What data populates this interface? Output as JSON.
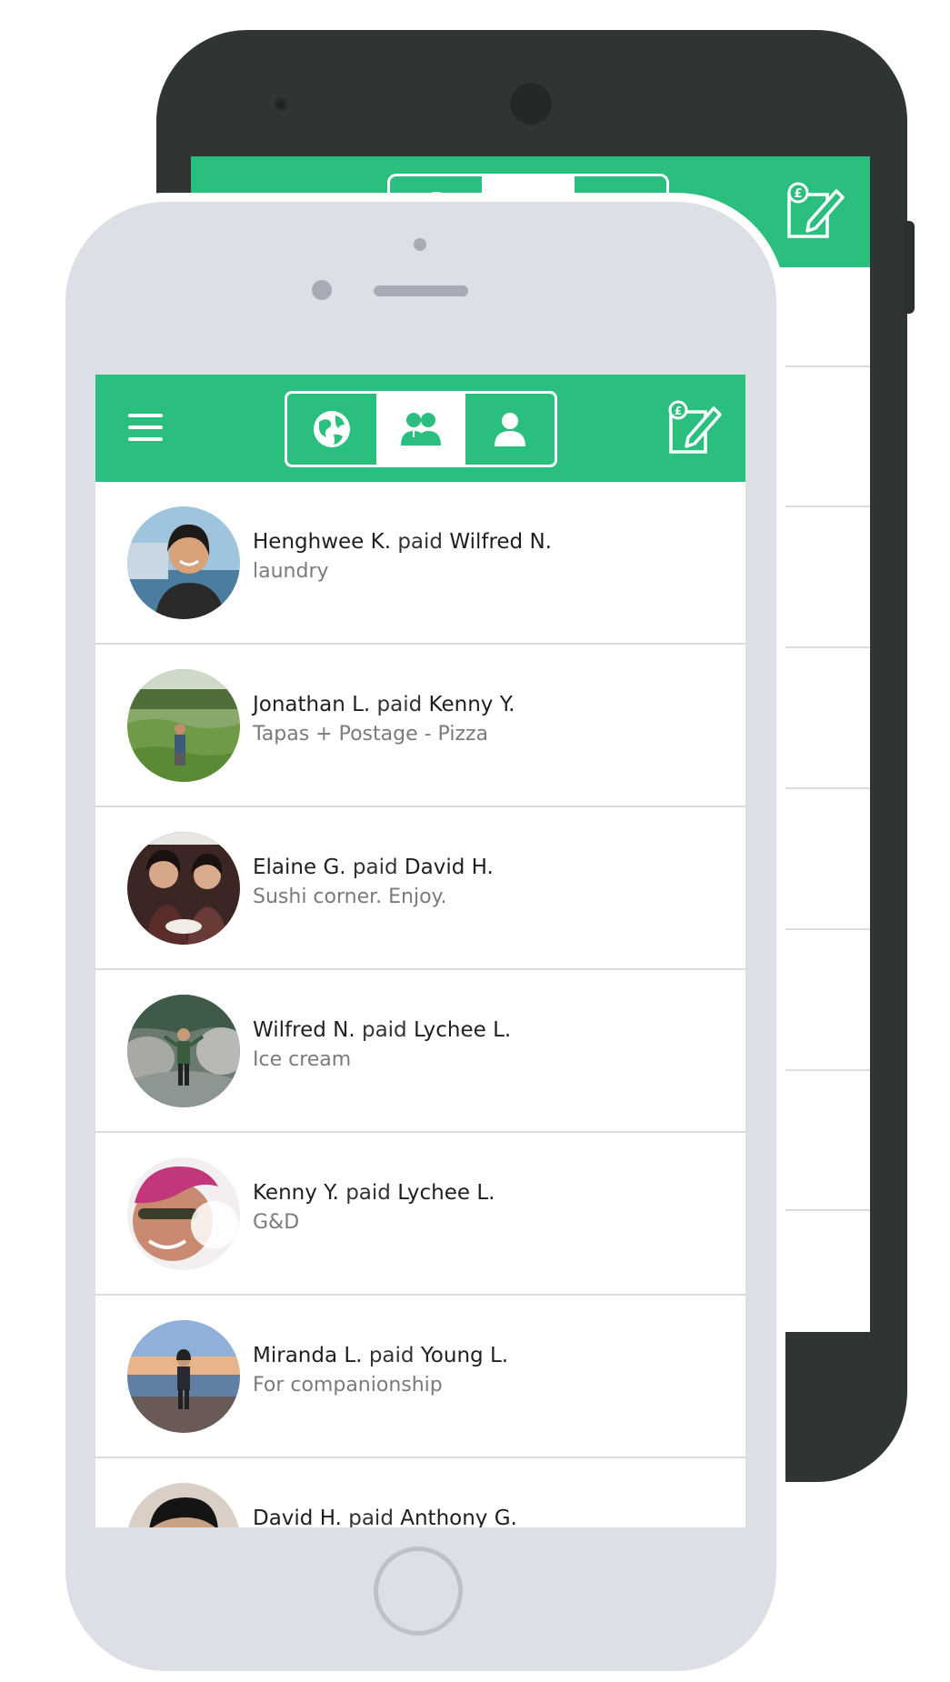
{
  "colors": {
    "accent": "#2bbf7f",
    "android_body": "#2e3533",
    "iphone_body": "#dcdfe6"
  },
  "header": {
    "menu_icon": "hamburger-menu-icon",
    "tabs": [
      {
        "name": "global",
        "icon": "globe-icon",
        "active": false
      },
      {
        "name": "friends",
        "icon": "friends-icon",
        "active": true
      },
      {
        "name": "personal",
        "icon": "person-icon",
        "active": false
      }
    ],
    "compose_icon": "compose-payment-icon"
  },
  "feed": [
    {
      "payer": "Henghwee K.",
      "verb": "paid",
      "payee": "Wilfred N.",
      "note": "laundry"
    },
    {
      "payer": "Jonathan L.",
      "verb": "paid",
      "payee": "Kenny Y.",
      "note": "Tapas + Postage - Pizza"
    },
    {
      "payer": "Elaine G.",
      "verb": "paid",
      "payee": "David H.",
      "note": "Sushi corner. Enjoy."
    },
    {
      "payer": "Wilfred N.",
      "verb": "paid",
      "payee": "Lychee L.",
      "note": "Ice cream"
    },
    {
      "payer": "Kenny Y.",
      "verb": "paid",
      "payee": "Lychee L.",
      "note": "G&D"
    },
    {
      "payer": "Miranda L.",
      "verb": "paid",
      "payee": "Young L.",
      "note": "For companionship"
    },
    {
      "payer": "David H.",
      "verb": "paid",
      "payee": "Anthony G.",
      "note": ""
    }
  ]
}
